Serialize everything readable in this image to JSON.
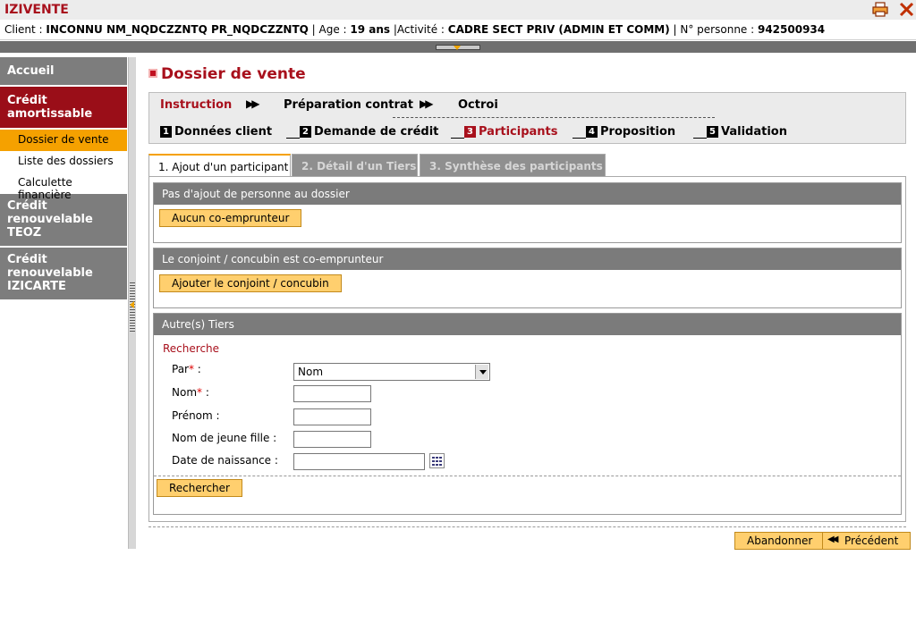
{
  "app": {
    "title": "IZIVENTE"
  },
  "client": {
    "client_label": "Client : ",
    "client_value": "INCONNU NM_NQDCZZNTQ PR_NQDCZZNTQ",
    "age_label": " | Age : ",
    "age_value": "19 ans",
    "activity_label": " |Activité : ",
    "activity_value": "CADRE SECT PRIV (ADMIN ET COMM)",
    "person_label": " | N° personne : ",
    "person_value": "942500934"
  },
  "sidebar": {
    "home": "Accueil",
    "credit_amort": "Crédit amortissable",
    "sub_items": [
      "Dossier de vente",
      "Liste des dossiers",
      "Calculette financière"
    ],
    "renew_teoz": "Crédit renouvelable TEOZ",
    "renew_izicarte": "Crédit renouvelable IZICARTE"
  },
  "page": {
    "title": "Dossier de vente"
  },
  "phases": [
    "Instruction",
    "Préparation contrat",
    "Octroi"
  ],
  "steps": [
    {
      "num": "1",
      "label": "Données client"
    },
    {
      "num": "2",
      "label": "Demande de crédit"
    },
    {
      "num": "3",
      "label": "Participants"
    },
    {
      "num": "4",
      "label": "Proposition"
    },
    {
      "num": "5",
      "label": "Validation"
    }
  ],
  "tabs": [
    "1. Ajout d'un participant",
    "2. Détail d'un Tiers",
    "3. Synthèse des participants"
  ],
  "sections": {
    "no_add": {
      "title": "Pas d'ajout de personne au dossier",
      "button": "Aucun co-emprunteur"
    },
    "spouse": {
      "title": "Le conjoint / concubin est co-emprunteur",
      "button": "Ajouter le conjoint / concubin"
    },
    "others": {
      "title": "Autre(s) Tiers",
      "search_title": "Recherche",
      "by_label": "Par",
      "by_value": "Nom",
      "name_label": "Nom",
      "firstname_label": "Prénom :",
      "maiden_label": "Nom de jeune fille :",
      "birth_label": "Date de naissance :",
      "search_button": "Rechercher",
      "required_mark": "*",
      "colon": " :"
    }
  },
  "footer": {
    "cancel": "Abandonner",
    "previous": "Précédent"
  },
  "colors": {
    "brand": "#a8101c",
    "accent": "#f5a100",
    "button": "#ffcf6e"
  }
}
